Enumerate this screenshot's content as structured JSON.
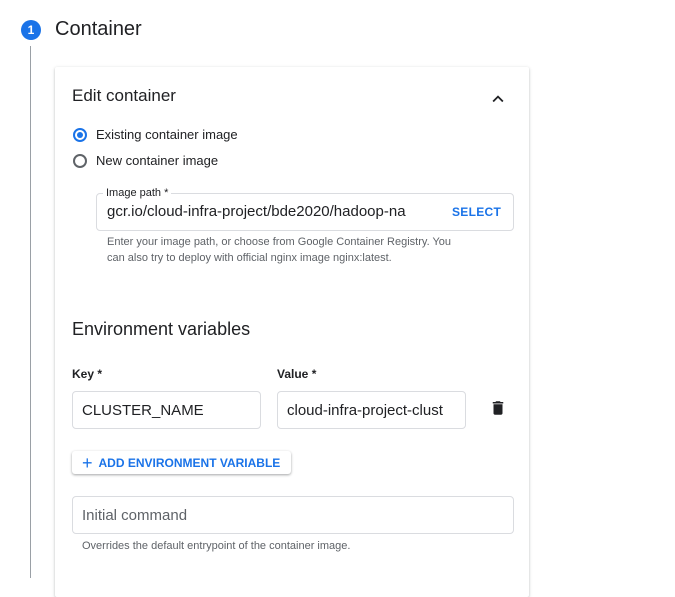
{
  "step": {
    "number": "1",
    "title": "Container"
  },
  "card": {
    "title": "Edit container",
    "radio_existing": "Existing container image",
    "radio_new": "New container image",
    "image_path": {
      "label": "Image path *",
      "value": "gcr.io/cloud-infra-project/bde2020/hadoop-na",
      "select_label": "SELECT",
      "help_line1": "Enter your image path, or choose from Google Container Registry. You",
      "help_line2": "can also try to deploy with official nginx image nginx:latest."
    },
    "env": {
      "title": "Environment variables",
      "key_label": "Key *",
      "value_label": "Value *",
      "key_value": "CLUSTER_NAME",
      "value_value": "cloud-infra-project-clust",
      "add_label": "ADD ENVIRONMENT VARIABLE"
    },
    "command": {
      "placeholder": "Initial command",
      "help": "Overrides the default entrypoint of the container image."
    }
  },
  "icons": {
    "step": "step-number-badge",
    "collapse": "chevron-up-icon",
    "delete": "trash-icon",
    "add": "plus-icon"
  },
  "colors": {
    "accent": "#1a73e8",
    "text": "#202124",
    "muted": "#5f6368",
    "border": "#dadce0"
  }
}
